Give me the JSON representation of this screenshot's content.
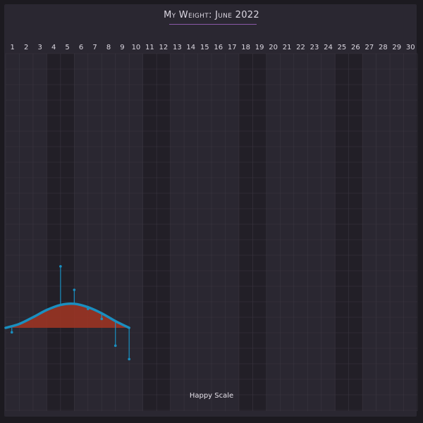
{
  "title": "My Weight: June 2022",
  "footer": "Happy Scale",
  "colors": {
    "background": "#2a2731",
    "weekend_shade": "#221f27",
    "grid": "#3a3640",
    "trend_line": "#1a8fc0",
    "trend_fill": "#9a3424",
    "day_label": "#ddd9e2"
  },
  "chart_data": {
    "type": "line",
    "title": "My Weight: June 2022",
    "xlabel": "",
    "ylabel": "",
    "x": [
      1,
      2,
      3,
      4,
      5,
      6,
      7,
      8,
      9,
      10,
      11,
      12,
      13,
      14,
      15,
      16,
      17,
      18,
      19,
      20,
      21,
      22,
      23,
      24,
      25,
      26,
      27,
      28,
      29,
      30
    ],
    "xlim": [
      1,
      30
    ],
    "weekend_days": [
      4,
      5,
      11,
      12,
      18,
      19,
      25,
      26
    ],
    "grid": true,
    "series": [
      {
        "kind": "trend",
        "days": [
          1,
          2,
          3,
          4,
          5,
          6,
          7,
          8,
          9,
          10
        ],
        "values": [
          0.0,
          0.35,
          0.95,
          1.6,
          2.05,
          2.15,
          1.85,
          1.3,
          0.6,
          0.0
        ]
      },
      {
        "kind": "daily_weighins",
        "days": [
          1,
          5,
          6,
          7,
          8,
          9,
          10
        ],
        "values": [
          -0.4,
          5.5,
          3.4,
          1.7,
          0.8,
          -1.6,
          -2.8
        ]
      }
    ],
    "ylim": [
      -7,
      25
    ]
  }
}
